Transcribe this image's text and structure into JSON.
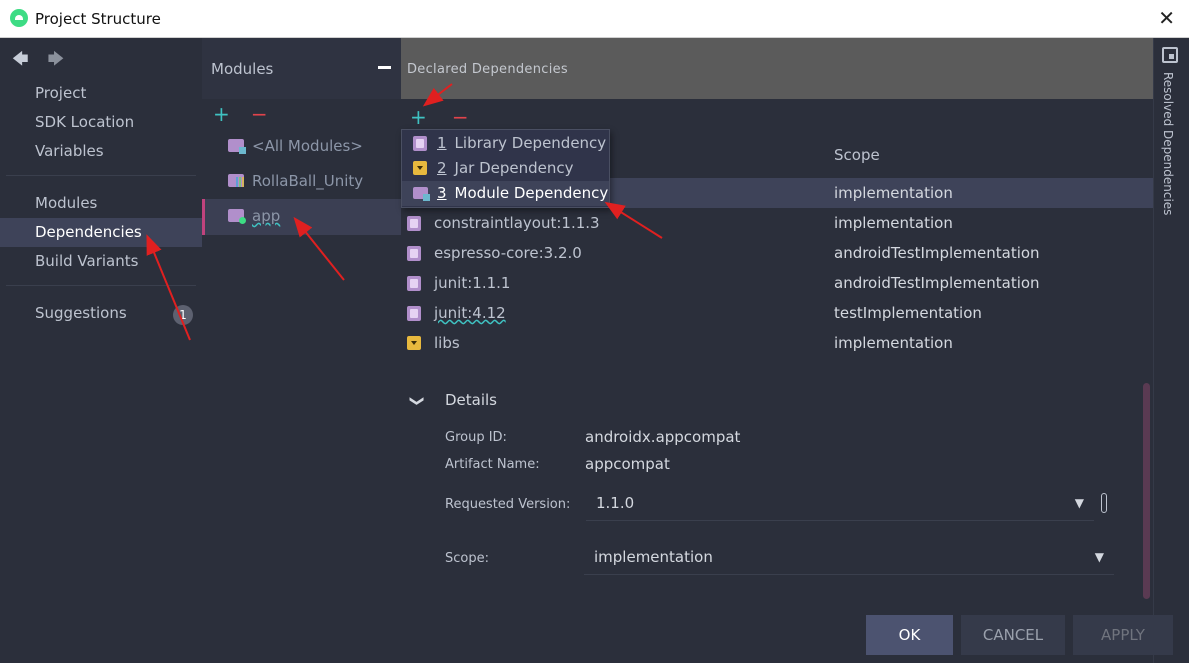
{
  "window": {
    "title": "Project Structure",
    "close_glyph": "✕"
  },
  "nav": {
    "back_glyph": "🡄",
    "forward_glyph": "🡆",
    "items": [
      {
        "label": "Project"
      },
      {
        "label": "SDK Location"
      },
      {
        "label": "Variables"
      },
      {
        "label": "Modules"
      },
      {
        "label": "Dependencies",
        "selected": true
      },
      {
        "label": "Build Variants"
      },
      {
        "label": "Suggestions",
        "badge": "1"
      }
    ]
  },
  "modules": {
    "title": "Modules",
    "add_glyph": "+",
    "remove_glyph": "−",
    "items": [
      {
        "label": "<All Modules>"
      },
      {
        "label": "RollaBall_Unity"
      },
      {
        "label": "app",
        "selected": true
      }
    ]
  },
  "declared": {
    "title": "Declared Dependencies",
    "add_glyph": "+",
    "remove_glyph": "−",
    "scope_header": "Scope",
    "rows": [
      {
        "name": "",
        "scope": "implementation",
        "icon": "library-icon",
        "selected": true
      },
      {
        "name": "constraintlayout:1.1.3",
        "scope": "implementation",
        "icon": "library-icon"
      },
      {
        "name": "espresso-core:3.2.0",
        "scope": "androidTestImplementation",
        "icon": "library-icon"
      },
      {
        "name": "junit:1.1.1",
        "scope": "androidTestImplementation",
        "icon": "library-icon"
      },
      {
        "name": "junit:4.12",
        "scope": "testImplementation",
        "icon": "library-icon"
      },
      {
        "name": "libs",
        "scope": "implementation",
        "icon": "jar-icon"
      }
    ]
  },
  "popup": {
    "items": [
      {
        "num": "1",
        "label": "Library Dependency",
        "icon": "library-icon"
      },
      {
        "num": "2",
        "label": "Jar Dependency",
        "icon": "jar-icon"
      },
      {
        "num": "3",
        "label": "Module Dependency",
        "icon": "module-icon",
        "selected": true
      }
    ]
  },
  "details": {
    "toggle_glyph": "❯",
    "title": "Details",
    "group_id_label": "Group ID:",
    "group_id": "androidx.appcompat",
    "artifact_label": "Artifact Name:",
    "artifact": "appcompat",
    "version_label": "Requested Version:",
    "version": "1.1.0",
    "scope_label": "Scope:",
    "scope": "implementation",
    "dropdown_glyph": "▼"
  },
  "right_strip": {
    "label": "Resolved Dependencies"
  },
  "buttons": {
    "ok": "OK",
    "cancel": "CANCEL",
    "apply": "APPLY"
  },
  "colors": {
    "accent_cyan": "#3fc2c2",
    "remove_red": "#e0434b",
    "selection": "#3e4359",
    "annotation_red": "#e02020"
  }
}
